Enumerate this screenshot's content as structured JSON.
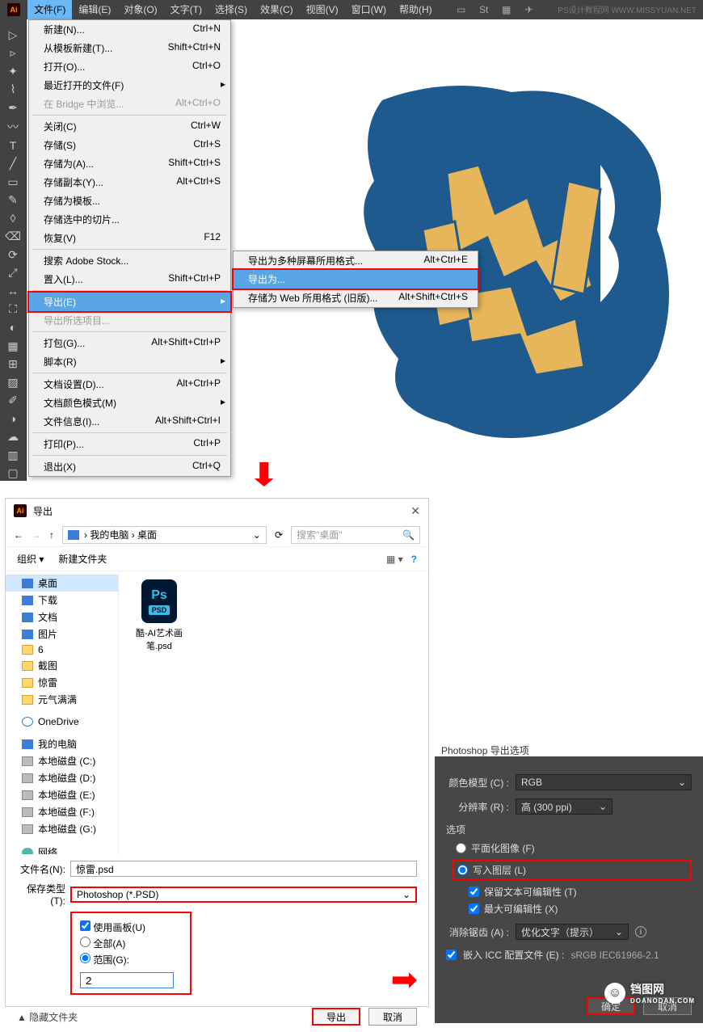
{
  "menubar": {
    "items": [
      "文件(F)",
      "编辑(E)",
      "对象(O)",
      "文字(T)",
      "选择(S)",
      "效果(C)",
      "视图(V)",
      "窗口(W)",
      "帮助(H)"
    ],
    "watermark": "PS设计教程网  WWW.MISSYUAN.NET"
  },
  "file_menu": [
    {
      "label": "新建(N)...",
      "shortcut": "Ctrl+N"
    },
    {
      "label": "从模板新建(T)...",
      "shortcut": "Shift+Ctrl+N"
    },
    {
      "label": "打开(O)...",
      "shortcut": "Ctrl+O"
    },
    {
      "label": "最近打开的文件(F)",
      "shortcut": "",
      "arrow": true
    },
    {
      "label": "在 Bridge 中浏览...",
      "shortcut": "Alt+Ctrl+O",
      "disabled": true
    },
    {
      "sep": true
    },
    {
      "label": "关闭(C)",
      "shortcut": "Ctrl+W"
    },
    {
      "label": "存储(S)",
      "shortcut": "Ctrl+S"
    },
    {
      "label": "存储为(A)...",
      "shortcut": "Shift+Ctrl+S"
    },
    {
      "label": "存储副本(Y)...",
      "shortcut": "Alt+Ctrl+S"
    },
    {
      "label": "存储为模板...",
      "shortcut": ""
    },
    {
      "label": "存储选中的切片...",
      "shortcut": ""
    },
    {
      "label": "恢复(V)",
      "shortcut": "F12"
    },
    {
      "sep": true
    },
    {
      "label": "搜索 Adobe Stock...",
      "shortcut": ""
    },
    {
      "label": "置入(L)...",
      "shortcut": "Shift+Ctrl+P"
    },
    {
      "sep": true
    },
    {
      "label": "导出(E)",
      "shortcut": "",
      "arrow": true,
      "hl": true
    },
    {
      "label": "导出所选项目...",
      "shortcut": "",
      "disabled": true
    },
    {
      "sep": true
    },
    {
      "label": "打包(G)...",
      "shortcut": "Alt+Shift+Ctrl+P"
    },
    {
      "label": "脚本(R)",
      "shortcut": "",
      "arrow": true
    },
    {
      "sep": true
    },
    {
      "label": "文档设置(D)...",
      "shortcut": "Alt+Ctrl+P"
    },
    {
      "label": "文档颜色模式(M)",
      "shortcut": "",
      "arrow": true
    },
    {
      "label": "文件信息(I)...",
      "shortcut": "Alt+Shift+Ctrl+I"
    },
    {
      "sep": true
    },
    {
      "label": "打印(P)...",
      "shortcut": "Ctrl+P"
    },
    {
      "sep": true
    },
    {
      "label": "退出(X)",
      "shortcut": "Ctrl+Q"
    }
  ],
  "export_submenu": [
    {
      "label": "导出为多种屏幕所用格式...",
      "shortcut": "Alt+Ctrl+E"
    },
    {
      "label": "导出为...",
      "shortcut": "",
      "hl": true
    },
    {
      "label": "存储为 Web 所用格式 (旧版)...",
      "shortcut": "Alt+Shift+Ctrl+S"
    }
  ],
  "export_dialog": {
    "title": "导出",
    "path_parts": [
      "我的电脑",
      "桌面"
    ],
    "search_placeholder": "搜索\"桌面\"",
    "organize": "组织 ▾",
    "newfolder": "新建文件夹",
    "tree": [
      {
        "label": "桌面",
        "type": "desktop",
        "sel": true
      },
      {
        "label": "下载",
        "type": "download"
      },
      {
        "label": "文档",
        "type": "doc"
      },
      {
        "label": "图片",
        "type": "pic"
      },
      {
        "label": "6",
        "type": "folder"
      },
      {
        "label": "截图",
        "type": "folder"
      },
      {
        "label": "惊雷",
        "type": "folder"
      },
      {
        "label": "元气满满",
        "type": "folder"
      },
      {
        "label": "OneDrive",
        "type": "cloud",
        "gap": true
      },
      {
        "label": "我的电脑",
        "type": "pc",
        "gap": true
      },
      {
        "label": "本地磁盘 (C:)",
        "type": "drive"
      },
      {
        "label": "本地磁盘 (D:)",
        "type": "drive"
      },
      {
        "label": "本地磁盘 (E:)",
        "type": "drive"
      },
      {
        "label": "本地磁盘 (F:)",
        "type": "drive"
      },
      {
        "label": "本地磁盘 (G:)",
        "type": "drive"
      },
      {
        "label": "网络",
        "type": "net",
        "gap": true
      }
    ],
    "file": {
      "name": "酷-AI艺术画笔.psd"
    },
    "filename_label": "文件名(N):",
    "filename_value": "惊雷.psd",
    "savetype_label": "保存类型(T):",
    "savetype_value": "Photoshop (*.PSD)",
    "opt_artboard": "使用画板(U)",
    "opt_all": "全部(A)",
    "opt_range": "范围(G):",
    "range_value": "2",
    "hide": "▲ 隐藏文件夹",
    "btn_export": "导出",
    "btn_cancel": "取消"
  },
  "ps_options": {
    "title": "Photoshop 导出选项",
    "color_model_label": "颜色模型 (C) :",
    "color_model_value": "RGB",
    "resolution_label": "分辨率 (R) :",
    "resolution_value": "高 (300 ppi)",
    "options_label": "选项",
    "opt_flat": "平面化图像 (F)",
    "opt_layers": "写入图层 (L)",
    "opt_preserve": "保留文本可编辑性 (T)",
    "opt_maxedit": "最大可编辑性 (X)",
    "antialias_label": "消除锯齿 (A) :",
    "antialias_value": "优化文字（提示）",
    "embed_icc": "嵌入 ICC 配置文件 (E) :",
    "icc_value": "sRGB IEC61966-2.1",
    "btn_ok": "确定",
    "btn_cancel": "取消"
  },
  "watermark": {
    "main": "铛图网",
    "sub": "DOANODAN.COM"
  }
}
